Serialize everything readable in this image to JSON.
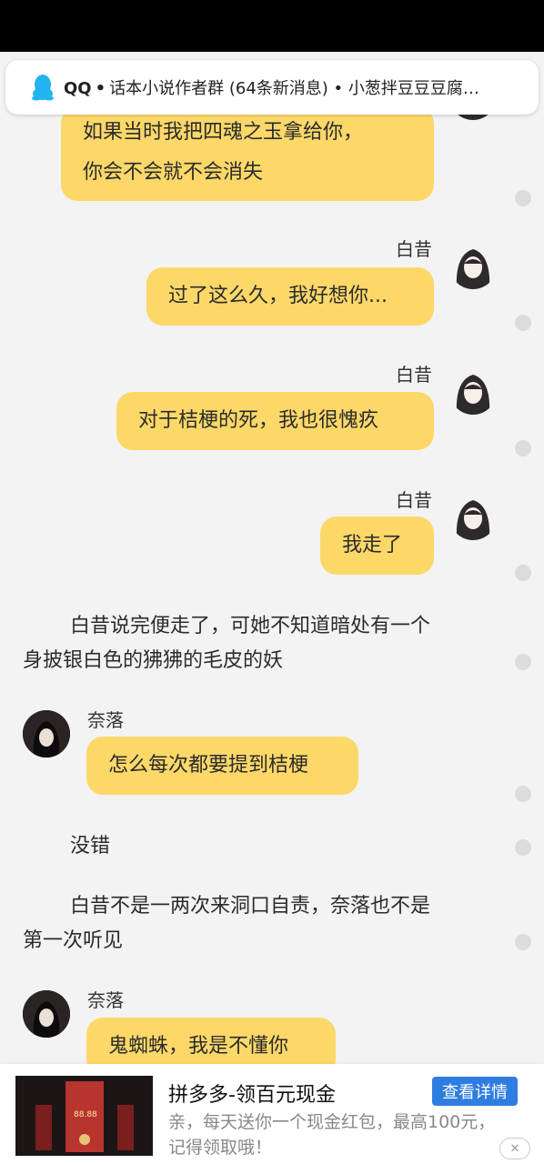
{
  "notification": {
    "app": "QQ",
    "dot": "•",
    "text": "话本小说作者群 (64条新消息) • 小葱拌豆豆豆腐…",
    "icon": "qq-penguin-icon"
  },
  "messages": [
    {
      "speaker": "",
      "lines": [
        "如果当时我把四魂之玉拿给你，",
        "你会不会就不会消失"
      ]
    },
    {
      "speaker": "白昔",
      "text": "过了这么久，我好想你..."
    },
    {
      "speaker": "白昔",
      "text": "对于桔梗的死，我也很愧疚"
    },
    {
      "speaker": "白昔",
      "text": "我走了"
    },
    {
      "narration": [
        "白昔说完便走了，可她不知道暗处有一个",
        "身披银白色的狒狒的毛皮的妖"
      ]
    },
    {
      "speaker": "奈落",
      "text": "怎么每次都要提到桔梗"
    },
    {
      "narration": [
        "没错"
      ]
    },
    {
      "narration": [
        "白昔不是一两次来洞口自责，奈落也不是",
        "第一次听见"
      ]
    },
    {
      "speaker": "奈落",
      "text": "鬼蜘蛛，我是不懂你"
    }
  ],
  "ad": {
    "title": "拼多多-领百元现金",
    "button": "查看详情",
    "description": "亲，每天送你一个现金红包，最高100元，记得领取哦！",
    "thumb_amount": "88.88",
    "close": "✕"
  },
  "colors": {
    "bubble": "#fcd869",
    "background": "#f3f3f3",
    "button": "#2f7de1"
  }
}
